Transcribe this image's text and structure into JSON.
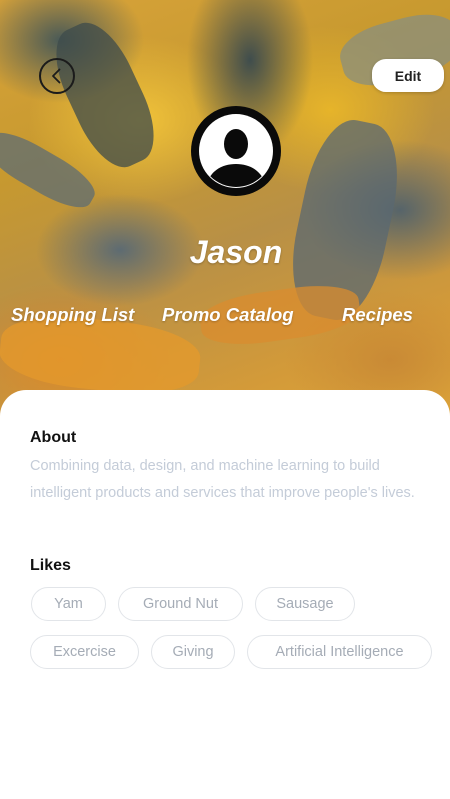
{
  "header": {
    "edit_label": "Edit",
    "profile_name": "Jason"
  },
  "nav": {
    "items": [
      "Shopping List",
      "Promo Catalog",
      "Recipes"
    ]
  },
  "about": {
    "title": "About",
    "text": "Combining data, design, and machine learning to build intelligent products and services that improve people's lives."
  },
  "likes": {
    "title": "Likes",
    "items": [
      "Yam",
      "Ground Nut",
      "Sausage",
      "Excercise",
      "Giving",
      "Artificial Intelligence"
    ]
  }
}
